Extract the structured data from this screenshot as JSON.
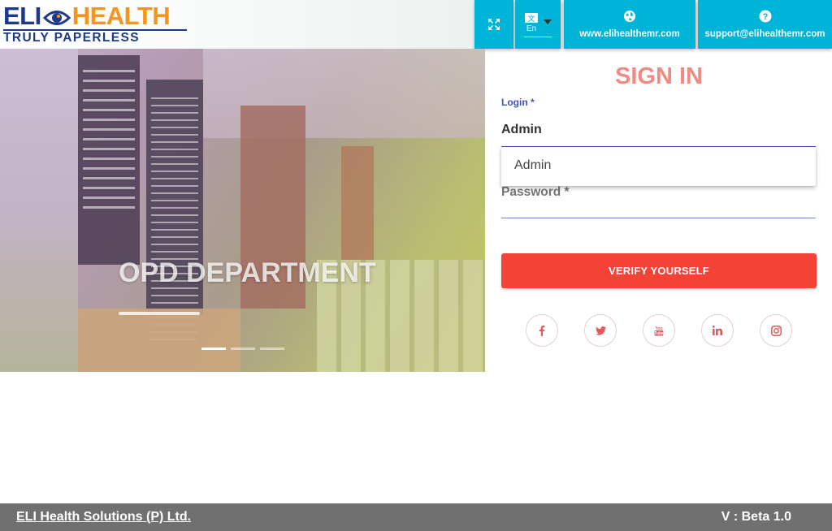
{
  "header": {
    "logo_top_left": "ELI",
    "logo_top_right": "HEALTH",
    "logo_tagline": "TRULY PAPERLESS",
    "website_label": "www.elihealthemr.com",
    "support_label": "support@elihealthemr.com",
    "language_icon_text": "En"
  },
  "hero": {
    "caption": "OPD DEPARTMENT",
    "slides_count": 3,
    "active_slide": 1
  },
  "signin": {
    "title": "SIGN IN",
    "login_label": "Login *",
    "login_value": "Admin",
    "autocomplete_option": "Admin",
    "password_label": "Password *",
    "verify_button": "VERIFY YOURSELF"
  },
  "social": [
    "facebook",
    "twitter",
    "youtube",
    "linkedin",
    "instagram"
  ],
  "footer": {
    "company": "ELI Health Solutions (P) Ltd.",
    "version": "V : Beta 1.0"
  },
  "colors": {
    "accent": "#00b4d8",
    "primary_button": "#f44336",
    "title": "#f28a84",
    "field_focus": "#3f51b5",
    "footer": "#707070",
    "logo_blue": "#1d3a8a",
    "logo_orange": "#f7941d",
    "social_icon": "#e4585a"
  }
}
